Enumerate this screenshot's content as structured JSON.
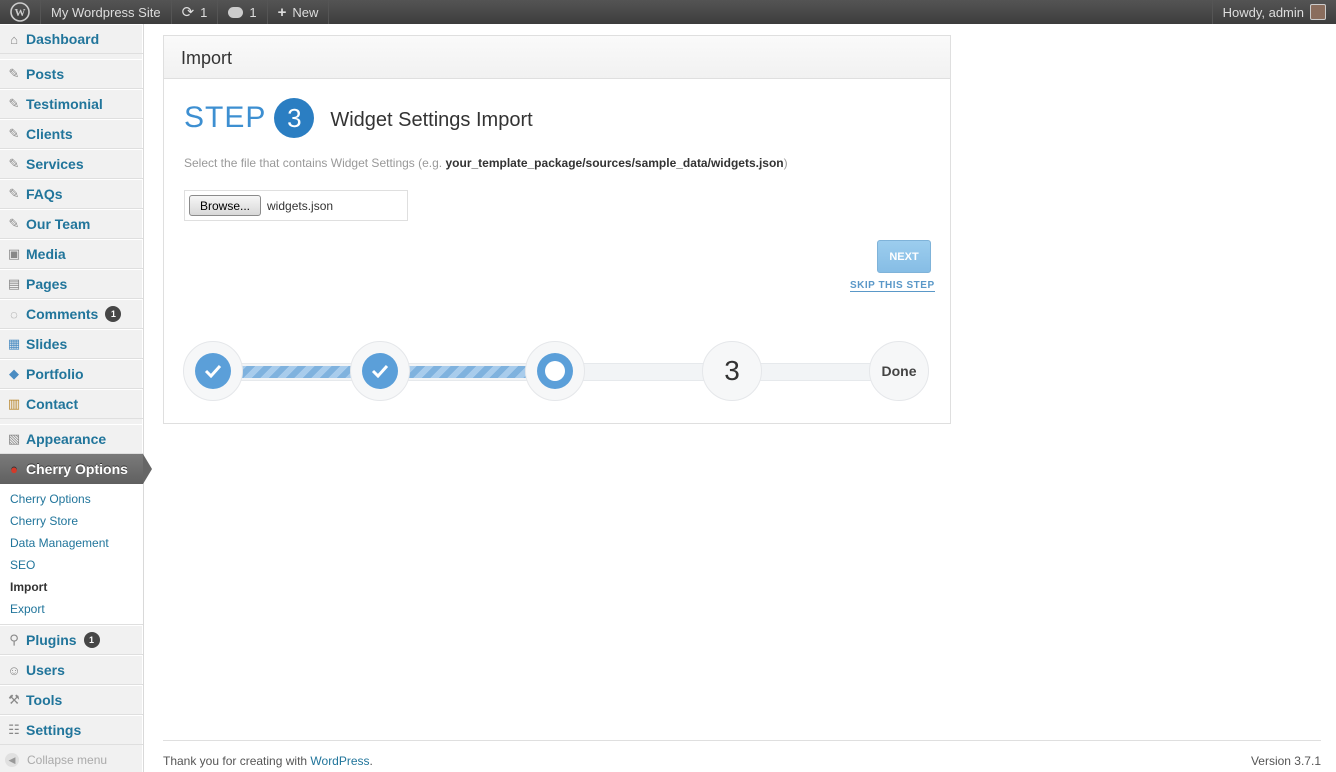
{
  "adminbar": {
    "site_name": "My Wordpress Site",
    "updates_count": "1",
    "comments_count": "1",
    "new_label": "New",
    "howdy": "Howdy, admin"
  },
  "sidebar": {
    "items": [
      {
        "label": "Dashboard",
        "icon": "dashboard-icon"
      },
      {
        "label": "Posts",
        "icon": "pin-icon"
      },
      {
        "label": "Testimonial",
        "icon": "pin-icon"
      },
      {
        "label": "Clients",
        "icon": "pin-icon"
      },
      {
        "label": "Services",
        "icon": "pin-icon"
      },
      {
        "label": "FAQs",
        "icon": "pin-icon"
      },
      {
        "label": "Our Team",
        "icon": "pin-icon"
      },
      {
        "label": "Media",
        "icon": "media-icon"
      },
      {
        "label": "Pages",
        "icon": "pages-icon"
      },
      {
        "label": "Comments",
        "icon": "comments-icon",
        "badge": "1"
      },
      {
        "label": "Slides",
        "icon": "slides-icon"
      },
      {
        "label": "Portfolio",
        "icon": "portfolio-icon"
      },
      {
        "label": "Contact",
        "icon": "contact-icon"
      },
      {
        "label": "Appearance",
        "icon": "appearance-icon"
      },
      {
        "label": "Cherry Options",
        "icon": "cherry-icon"
      },
      {
        "label": "Plugins",
        "icon": "plugins-icon",
        "badge": "1"
      },
      {
        "label": "Users",
        "icon": "users-icon"
      },
      {
        "label": "Tools",
        "icon": "tools-icon"
      },
      {
        "label": "Settings",
        "icon": "settings-icon"
      }
    ],
    "submenu": [
      "Cherry Options",
      "Cherry Store",
      "Data Management",
      "SEO",
      "Import",
      "Export"
    ],
    "collapse_label": "Collapse menu"
  },
  "panel": {
    "title": "Import",
    "step_word": "STEP",
    "step_number": "3",
    "step_title": "Widget Settings Import",
    "hint_prefix": "Select the file that contains Widget Settings (e.g. ",
    "hint_path": "your_template_package/sources/sample_data/widgets.json",
    "hint_suffix": ")",
    "browse_label": "Browse...",
    "file_name": "widgets.json",
    "next_label": "NEXT",
    "skip_label": "SKIP THIS STEP"
  },
  "progress": {
    "node_4_label": "3",
    "done_label": "Done",
    "completed_fraction": 0.5
  },
  "footer": {
    "thanks_prefix": "Thank you for creating with ",
    "wp_link": "WordPress",
    "thanks_suffix": ".",
    "version": "Version 3.7.1"
  },
  "colors": {
    "accent": "#21759b",
    "step_blue": "#2b7ec2",
    "adminbar": "#464646"
  }
}
